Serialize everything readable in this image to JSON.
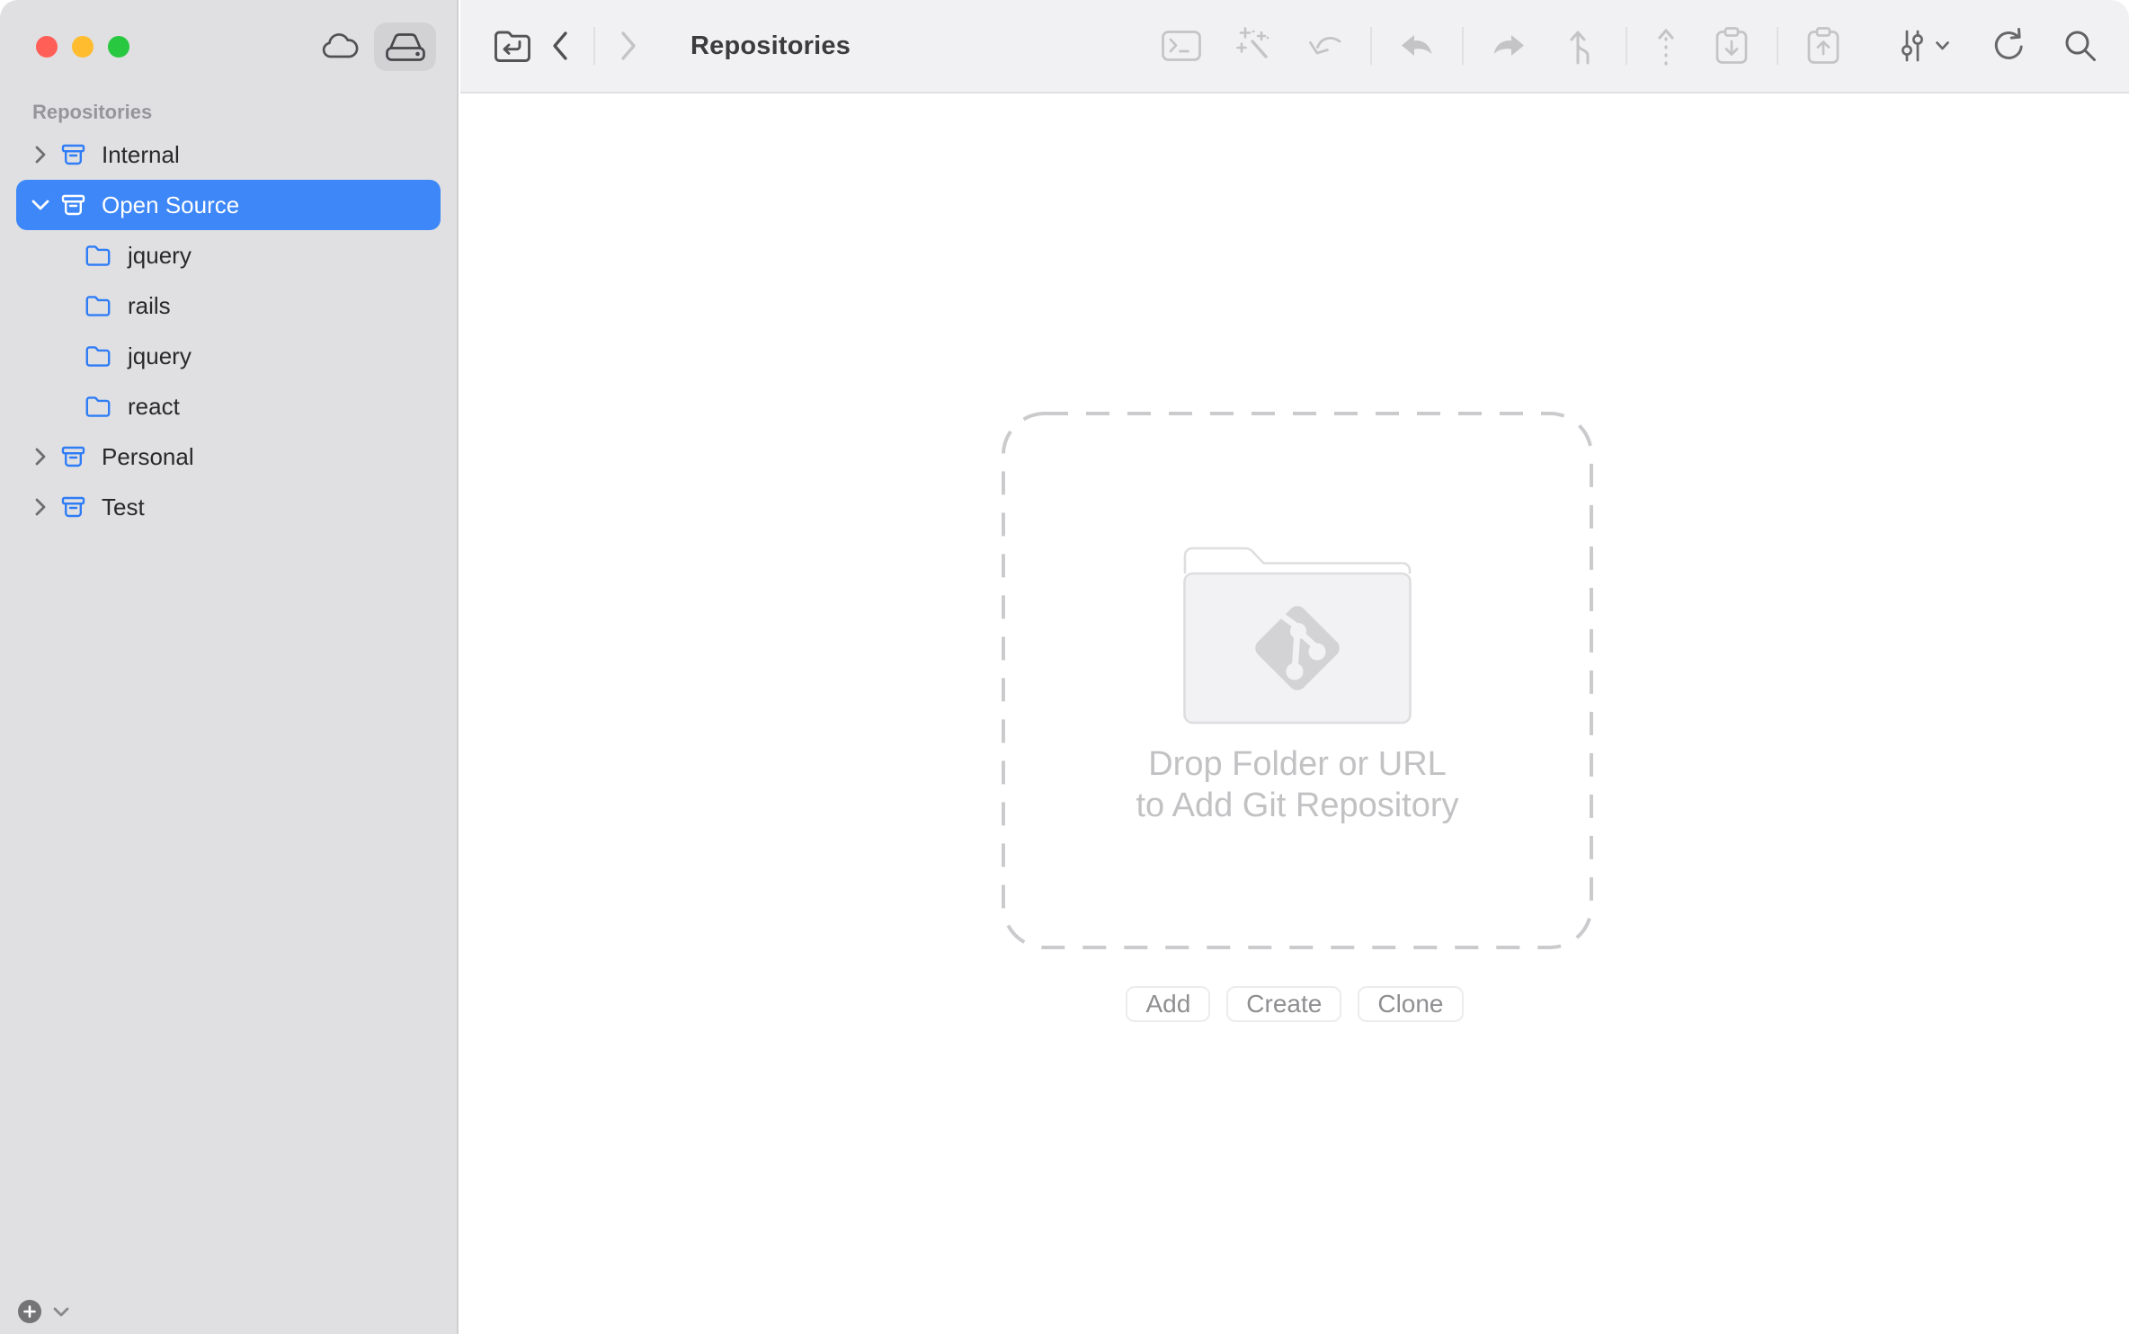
{
  "window": {
    "app_kind": "git-client-repository-manager",
    "traffic_lights": [
      "close",
      "minimize",
      "zoom"
    ]
  },
  "colors": {
    "accent_blue": "#2e7cf6",
    "selection_blue": "#3d87f8",
    "sidebar_bg": "#e0e0e2",
    "toolbar_bg": "#f1f1f3",
    "traffic_red": "#ff5f57",
    "traffic_yellow": "#febc2e",
    "traffic_green": "#28c840",
    "disabled_icon": "#c4c4c7",
    "enabled_icon": "#68686b",
    "drop_text": "#c2c2c4"
  },
  "titlebar": {
    "view_toggle": [
      {
        "icon": "cloud-icon",
        "active": false
      },
      {
        "icon": "drive-icon",
        "active": true
      }
    ]
  },
  "toolbar": {
    "title": "Repositories",
    "left_icons": [
      "back-to-repositories-icon",
      "back-icon",
      "forward-icon"
    ],
    "right_icons": [
      "terminal-icon",
      "magic-wand-icon",
      "undo-arrow-icon",
      "stash-arrow-left-icon",
      "apply-arrow-right-icon",
      "merge-branch-icon",
      "push-dashed-arrow-icon",
      "clipboard-down-icon",
      "clipboard-up-icon",
      "branch-options-icon",
      "chevron-down-icon",
      "refresh-icon",
      "search-icon"
    ]
  },
  "sidebar": {
    "header": "Repositories",
    "tree": [
      {
        "label": "Internal",
        "type": "group",
        "icon": "archive-box-icon",
        "state": "collapsed",
        "selected": false,
        "level": 0
      },
      {
        "label": "Open Source",
        "type": "group",
        "icon": "archive-box-icon",
        "state": "expanded",
        "selected": true,
        "level": 0
      },
      {
        "label": "jquery",
        "type": "repository",
        "icon": "folder-icon",
        "level": 1
      },
      {
        "label": "rails",
        "type": "repository",
        "icon": "folder-icon",
        "level": 1
      },
      {
        "label": "jquery",
        "type": "repository",
        "icon": "folder-icon",
        "level": 1
      },
      {
        "label": "react",
        "type": "repository",
        "icon": "folder-icon",
        "level": 1
      },
      {
        "label": "Personal",
        "type": "group",
        "icon": "archive-box-icon",
        "state": "collapsed",
        "selected": false,
        "level": 0
      },
      {
        "label": "Test",
        "type": "group",
        "icon": "archive-box-icon",
        "state": "collapsed",
        "selected": false,
        "level": 0
      }
    ],
    "footer_icons": [
      "add-plus-icon",
      "chevron-down-icon"
    ]
  },
  "main": {
    "dropzone": {
      "icon": "git-folder-icon",
      "line1": "Drop Folder or URL",
      "line2": "to Add Git Repository"
    },
    "buttons": [
      {
        "label": "Add"
      },
      {
        "label": "Create"
      },
      {
        "label": "Clone"
      }
    ]
  }
}
